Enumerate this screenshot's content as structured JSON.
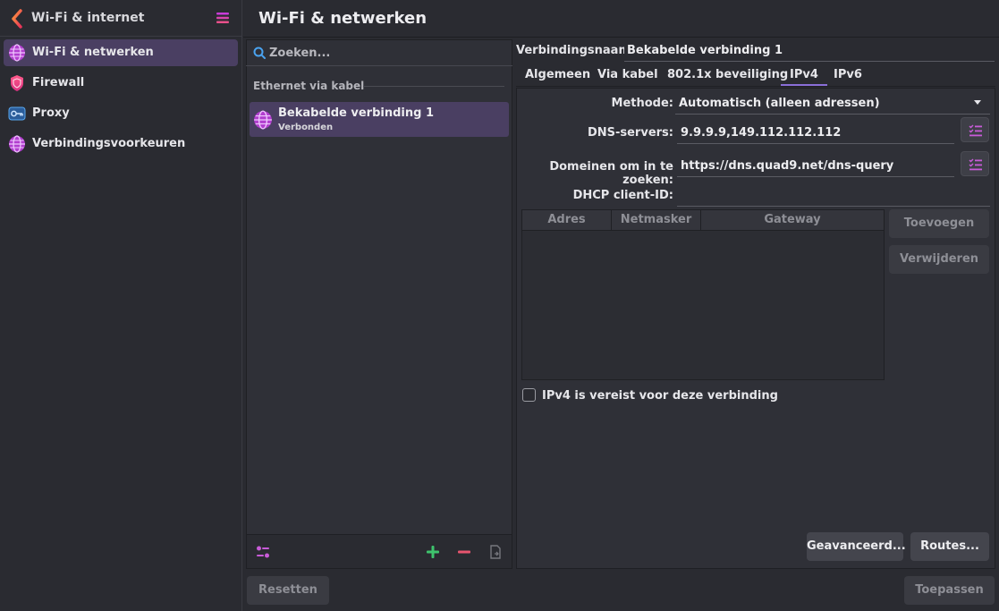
{
  "sidebar": {
    "title": "Wi-Fi & internet",
    "items": [
      {
        "label": "Wi-Fi & netwerken",
        "icon": "globe-icon"
      },
      {
        "label": "Firewall",
        "icon": "shield-icon"
      },
      {
        "label": "Proxy",
        "icon": "key-icon"
      },
      {
        "label": "Verbindingsvoorkeuren",
        "icon": "globe-icon"
      }
    ]
  },
  "header": {
    "title": "Wi-Fi & netwerken"
  },
  "connections": {
    "search_placeholder": "Zoeken...",
    "group_label": "Ethernet via kabel",
    "items": [
      {
        "name": "Bekabelde verbinding 1",
        "status": "Verbonden"
      }
    ]
  },
  "detail": {
    "connection_name_label": "Verbindingsnaam:",
    "connection_name": "Bekabelde verbinding 1",
    "tabs": [
      "Algemeen",
      "Via kabel",
      "802.1x beveiliging",
      "IPv4",
      "IPv6"
    ],
    "active_tab": "IPv4",
    "method_label": "Methode:",
    "method_value": "Automatisch (alleen adressen)",
    "dns_label": "DNS-servers:",
    "dns_value": "9.9.9.9,149.112.112.112",
    "domains_label": "Domeinen om in te zoeken:",
    "domains_value": "https://dns.quad9.net/dns-query",
    "dhcp_label": "DHCP client-ID:",
    "dhcp_value": "",
    "table_headers": [
      "Adres",
      "Netmasker",
      "Gateway"
    ],
    "add_button": "Toevoegen",
    "remove_button": "Verwijderen",
    "ipv4_required_label": "IPv4 is vereist voor deze verbinding",
    "advanced_button": "Geavanceerd...",
    "routes_button": "Routes..."
  },
  "footer": {
    "reset_button": "Resetten",
    "apply_button": "Toepassen"
  },
  "colors": {
    "accent": "#8a6fd8",
    "selection": "#4a3f62",
    "add": "#3ec46d",
    "remove": "#e8556f",
    "icon_purple": "#c85bd8"
  }
}
